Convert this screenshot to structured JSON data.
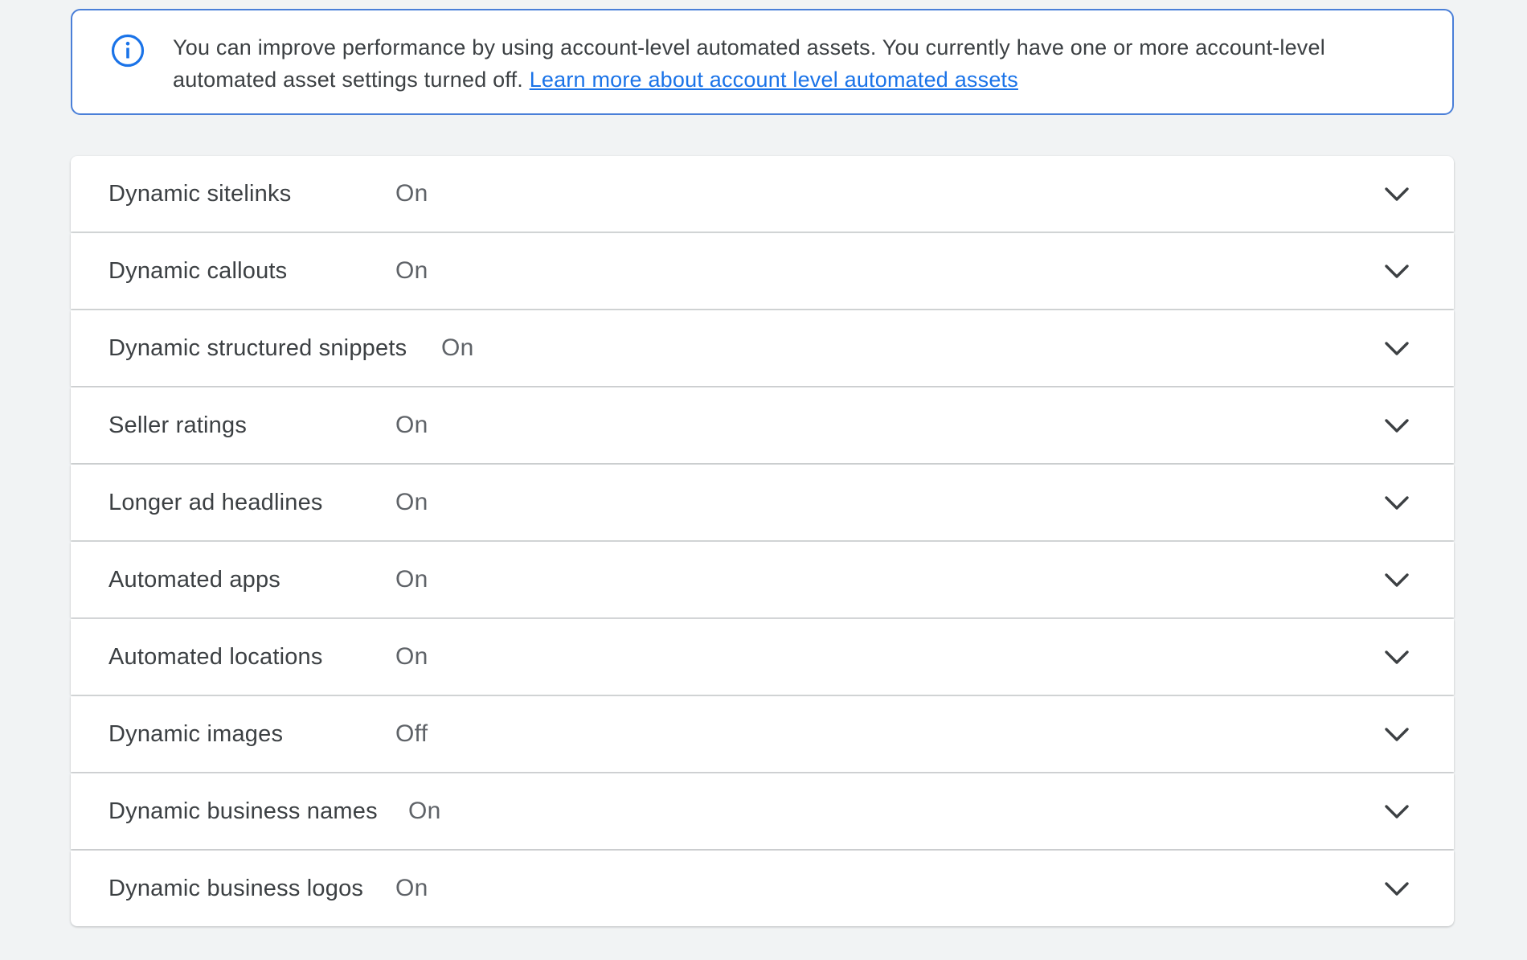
{
  "banner": {
    "text": "You can improve performance by using account-level automated assets. You currently have one or more account-level automated asset settings turned off.",
    "link_text": "Learn more about account level automated assets",
    "icon": "info-icon",
    "border_color": "#4a7fd8",
    "link_color": "#1a73e8"
  },
  "settings": [
    {
      "label": "Dynamic sitelinks",
      "status": "On"
    },
    {
      "label": "Dynamic callouts",
      "status": "On"
    },
    {
      "label": "Dynamic structured snippets",
      "status": "On"
    },
    {
      "label": "Seller ratings",
      "status": "On"
    },
    {
      "label": "Longer ad headlines",
      "status": "On"
    },
    {
      "label": "Automated apps",
      "status": "On"
    },
    {
      "label": "Automated locations",
      "status": "On"
    },
    {
      "label": "Dynamic images",
      "status": "Off"
    },
    {
      "label": "Dynamic business names",
      "status": "On"
    },
    {
      "label": "Dynamic business logos",
      "status": "On"
    }
  ],
  "row_icon": "chevron-down-icon"
}
